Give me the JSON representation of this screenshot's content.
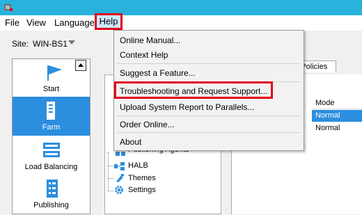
{
  "menubar": {
    "items": [
      "File",
      "View",
      "Language",
      "Help"
    ]
  },
  "site": {
    "label": "Site:",
    "value": "WIN-BS1"
  },
  "nav": {
    "items": [
      {
        "label": "Start",
        "selected": false
      },
      {
        "label": "Farm",
        "selected": true
      },
      {
        "label": "Load Balancing",
        "selected": false
      },
      {
        "label": "Publishing",
        "selected": false
      }
    ]
  },
  "tree": {
    "items": [
      "Publishing Agents",
      "HALB",
      "Themes",
      "Settings"
    ]
  },
  "tabs": {
    "visible_fragment": "ng Policies"
  },
  "grid": {
    "header": "Mode",
    "rows": [
      "Normal",
      "Normal"
    ]
  },
  "help_menu": {
    "items": [
      "Online Manual...",
      "Context Help",
      "Suggest a Feature...",
      "Troubleshooting and Request Support...",
      "Upload System Report to Parallels...",
      "Order Online...",
      "About"
    ],
    "highlighted_item": "Troubleshooting and Request Support..."
  },
  "colors": {
    "titlebar": "#28b2dc",
    "selection": "#2c8ede",
    "highlight_border": "#e1001a"
  }
}
